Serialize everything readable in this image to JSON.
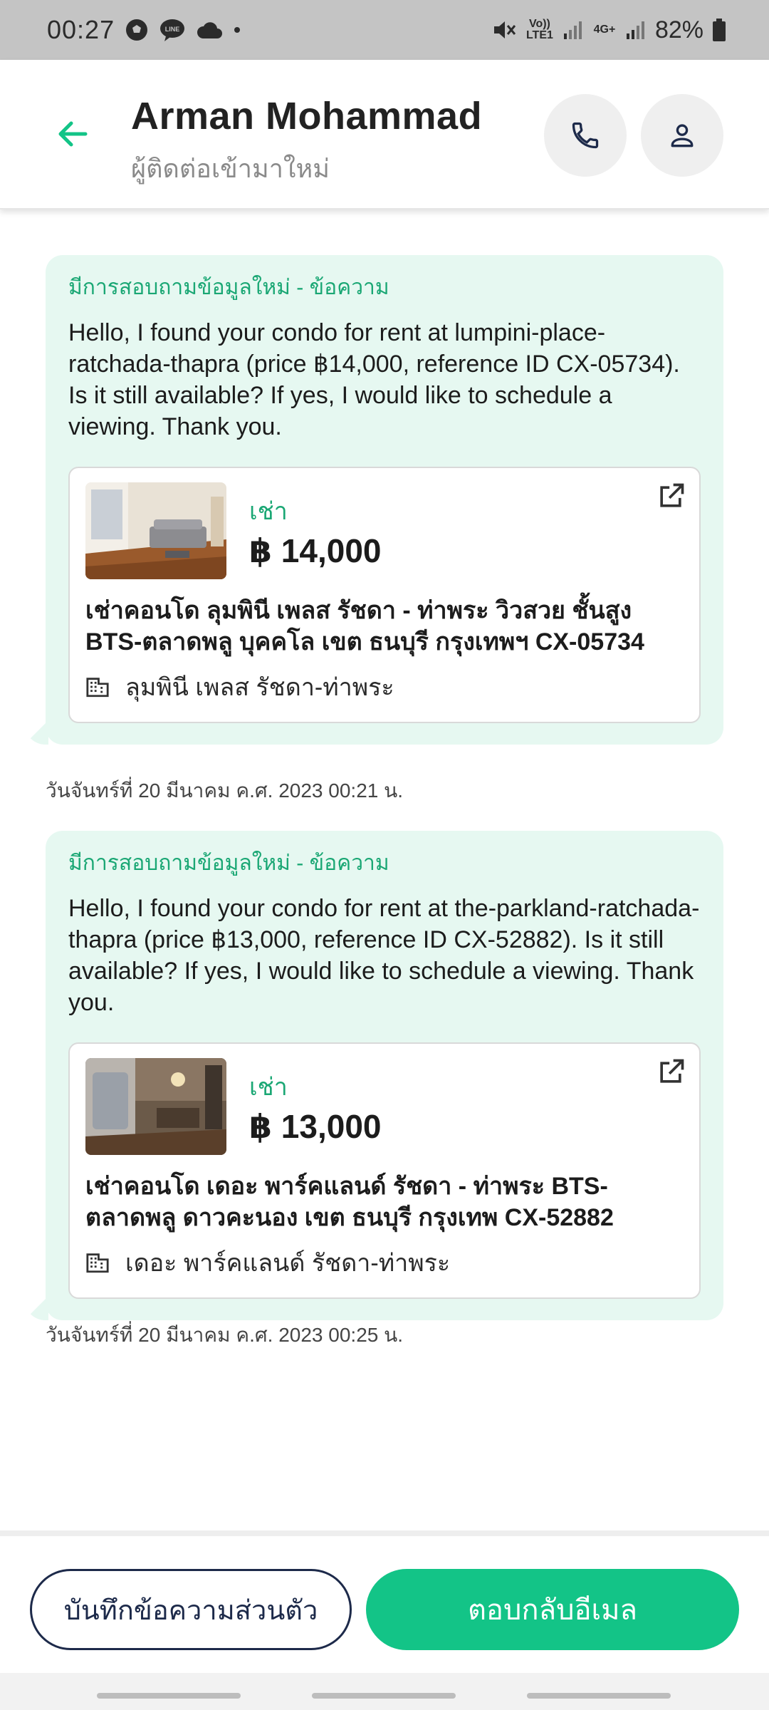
{
  "status_bar": {
    "time": "00:27",
    "network_label": "Vo)) LTE1",
    "network_type": "4G+",
    "battery": "82%"
  },
  "header": {
    "name": "Arman Mohammad",
    "subtitle": "ผู้ติดต่อเข้ามาใหม่"
  },
  "messages": [
    {
      "kicker": "มีการสอบถามข้อมูลใหม่ - ข้อความ",
      "text": "Hello, I found your condo for rent at lumpini-place-ratchada-thapra (price ฿14,000, reference ID CX-05734). Is it still available? If yes, I would like to schedule a viewing. Thank you.",
      "listing": {
        "rent_label": "เช่า",
        "price": "฿ 14,000",
        "title": "เช่าคอนโด ลุมพินี เพลส รัชดา - ท่าพระ วิวสวย ชั้นสูง BTS-ตลาดพลู บุคคโล เขต ธนบุรี กรุงเทพฯ CX-05734",
        "project": "ลุมพินี เพลส รัชดา-ท่าพระ"
      },
      "timestamp": "วันจันทร์ที่ 20 มีนาคม ค.ศ. 2023 00:21 น."
    },
    {
      "kicker": "มีการสอบถามข้อมูลใหม่ - ข้อความ",
      "text": "Hello, I found your condo for rent at the-parkland-ratchada-thapra (price ฿13,000, reference ID CX-52882). Is it still available? If yes, I would like to schedule a viewing. Thank you.",
      "listing": {
        "rent_label": "เช่า",
        "price": "฿ 13,000",
        "title": "เช่าคอนโด  เดอะ พาร์คแลนด์ รัชดา - ท่าพระ BTS-ตลาดพลู ดาวคะนอง เขต ธนบุรี กรุงเทพ CX-52882",
        "project": "เดอะ พาร์คแลนด์ รัชดา-ท่าพระ"
      },
      "timestamp": "วันจันทร์ที่ 20 มีนาคม ค.ศ. 2023 00:25 น."
    }
  ],
  "actions": {
    "note_label": "บันทึกข้อความส่วนตัว",
    "reply_label": "ตอบกลับอีเมล"
  },
  "colors": {
    "accent": "#13c487",
    "accent_text": "#1aa774",
    "bubble": "#e6f8f1",
    "note_border": "#1d2a4a"
  },
  "icons": {
    "back": "arrow-left-icon",
    "call": "phone-icon",
    "profile": "person-icon",
    "external": "open-external-icon",
    "building": "building-icon"
  }
}
